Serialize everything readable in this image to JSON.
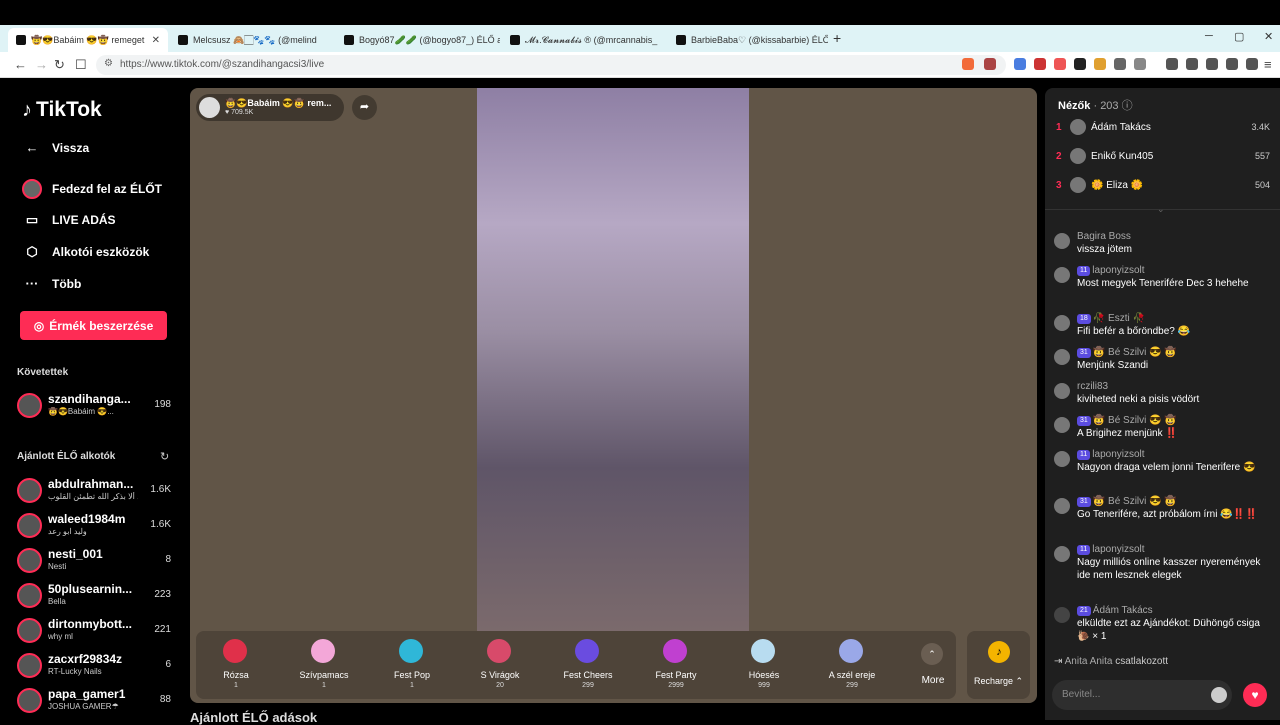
{
  "browser": {
    "tabs": [
      {
        "title": "🤠😎Babáim 😎🤠 remeget"
      },
      {
        "title": "Melcsusz 🙈🏻🐾🐾 (@melind"
      },
      {
        "title": "Bogyó87🥒🥒 (@bogyo87_) ÉLŐ a"
      },
      {
        "title": "𝓜𝓻.𝓒𝓪𝓷𝓷𝓪𝓫𝓲𝓼 ® (@mrcannabis_"
      },
      {
        "title": "BarbieBaba♡ (@kissabarbie) ÉLŐ a"
      }
    ],
    "url": "https://www.tiktok.com/@szandihangacsi3/live"
  },
  "sidebar": {
    "logo": "TikTok",
    "back": "Vissza",
    "menu": [
      {
        "label": "Fedezd fel az ÉLŐT",
        "icon": "avatar"
      },
      {
        "label": "LIVE ADÁS",
        "icon": "camera-icon"
      },
      {
        "label": "Alkotói eszközök",
        "icon": "creator-tools-icon"
      },
      {
        "label": "Több",
        "icon": "more-dots-icon"
      }
    ],
    "coins_button": "Érmék beszerzése",
    "following_title": "Követettek",
    "following": [
      {
        "name": "szandihanga...",
        "sub": "🤠😎Babáim 😎...",
        "count": "198"
      }
    ],
    "suggested_title": "Ajánlott ÉLŐ alkotók",
    "suggested": [
      {
        "name": "abdulrahman...",
        "sub": "ألا بذكر الله تطمئن القلوب ..",
        "count": "1.6K"
      },
      {
        "name": "waleed1984m",
        "sub": "وليد ابو رعد",
        "count": "1.6K"
      },
      {
        "name": "nesti_001",
        "sub": "Nesti",
        "count": "8"
      },
      {
        "name": "50plusearnin...",
        "sub": "Bella",
        "count": "223"
      },
      {
        "name": "dirtonmybott...",
        "sub": "why ml",
        "count": "221"
      },
      {
        "name": "zacxrf29834z",
        "sub": "RT-Lucky Nails",
        "count": "6"
      },
      {
        "name": "papa_gamer1",
        "sub": "JOSHUA GAMER☂",
        "count": "88"
      }
    ],
    "bottom_title": "Ajánlott ÉLŐ adások"
  },
  "live": {
    "host_name": "🤠😎Babáim 😎🤠 rem...",
    "host_likes": "♥ 709.5K",
    "gifts": [
      {
        "name": "Rózsa",
        "price": "1",
        "color": "#e0304a"
      },
      {
        "name": "Szívpamacs",
        "price": "1",
        "color": "#f3a7d8"
      },
      {
        "name": "Fest Pop",
        "price": "1",
        "color": "#2fb7d8"
      },
      {
        "name": "S Virágok",
        "price": "20",
        "color": "#d84a6a"
      },
      {
        "name": "Fest Cheers",
        "price": "299",
        "color": "#6a4ce0"
      },
      {
        "name": "Fest Party",
        "price": "2999",
        "color": "#c040d0"
      },
      {
        "name": "Hóesés",
        "price": "999",
        "color": "#b8dcf0"
      },
      {
        "name": "A szél ereje",
        "price": "299",
        "color": "#9aa8e8"
      }
    ],
    "more_label": "More",
    "recharge_label": "Recharge ⌃"
  },
  "panel": {
    "viewers_title": "Nézők",
    "viewers_count": "· 203",
    "viewers": [
      {
        "rank": "1",
        "name": "Ádám Takács",
        "score": "3.4K"
      },
      {
        "rank": "2",
        "name": "Enikő Kun405",
        "score": "557"
      },
      {
        "rank": "3",
        "name": "🌼 Eliza 🌼",
        "score": "504"
      }
    ],
    "messages": [
      {
        "user": "Bagira Boss",
        "badges": "",
        "text": "vissza jötem"
      },
      {
        "user": "laponyizsolt",
        "badges": "11",
        "text": "Most megyek Tenerifére Dec 3 hehehe"
      },
      {
        "user": "🥀 Eszti 🥀",
        "badges": "18",
        "text": "Fifi befér a bőröndbe? 😂"
      },
      {
        "user": "🤠 Bé Szilvi 😎 🤠",
        "badges": "31",
        "text": "Menjünk Szandi"
      },
      {
        "user": "rczili83",
        "badges": "",
        "text": "kiviheted neki a pisis vödört"
      },
      {
        "user": "🤠 Bé Szilvi 😎 🤠",
        "badges": "31",
        "text": "A Brigihez menjünk ‼️"
      },
      {
        "user": "laponyizsolt",
        "badges": "11",
        "text": "Nagyon draga velem jonni Tenerifere 😎"
      },
      {
        "user": "🤠 Bé Szilvi 😎 🤠",
        "badges": "31",
        "text": "Go Tenerifére, azt próbálom írni 😂‼️‼️"
      },
      {
        "user": "laponyizsolt",
        "badges": "11",
        "text": "Nagy milliós online kasszer nyeremények ide nem lesznek elegek"
      },
      {
        "user": "Ádám Takács",
        "badges": "21",
        "text": "elküldte ezt az Ajándékot: Dühöngő csiga 🐌 × 1"
      }
    ],
    "join_user": "Anita Anita",
    "join_text": "csatlakozott",
    "input_placeholder": "Bevitel..."
  }
}
